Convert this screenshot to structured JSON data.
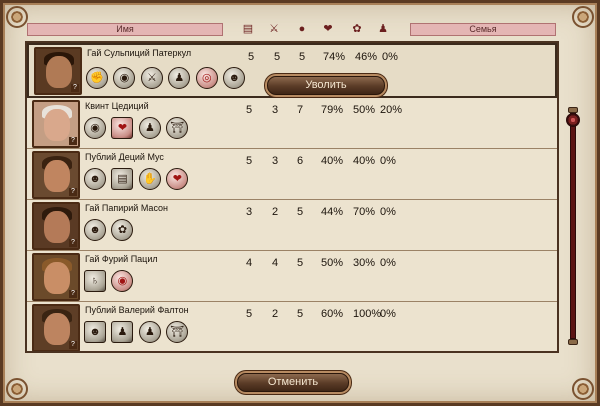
{
  "header": {
    "col_name": "Имя",
    "col_family": "Семья",
    "icons": [
      "scroll-icon",
      "crossed-swords-icon",
      "coins-icon",
      "heart-icon",
      "laurel-icon",
      "figure-icon"
    ]
  },
  "members": [
    {
      "name": "Гай Сульпиций Патеркул",
      "stats": [
        "5",
        "5",
        "5",
        "74%",
        "46%",
        "0%"
      ],
      "traits": [
        "fist-icon",
        "coin-icon",
        "fighter-icon",
        "pair-icon",
        "target-icon",
        "bust-icon"
      ]
    },
    {
      "name": "Квинт Цедиций",
      "stats": [
        "5",
        "3",
        "7",
        "79%",
        "50%",
        "20%"
      ],
      "traits": [
        "coins-icon",
        "heart-icon",
        "soldier-icon",
        "temple-icon"
      ]
    },
    {
      "name": "Публий Деций Мус",
      "stats": [
        "5",
        "3",
        "6",
        "40%",
        "40%",
        "0%"
      ],
      "traits": [
        "portrait-icon",
        "scroll-icon",
        "hand-icon",
        "heart-figure-icon"
      ]
    },
    {
      "name": "Гай Папирий Масон",
      "stats": [
        "3",
        "2",
        "5",
        "44%",
        "70%",
        "0%"
      ],
      "traits": [
        "head-icon",
        "wreath-icon"
      ]
    },
    {
      "name": "Гай Фурий Пацил",
      "stats": [
        "4",
        "4",
        "5",
        "50%",
        "30%",
        "0%"
      ],
      "traits": [
        "eagle-icon",
        "eye-icon"
      ]
    },
    {
      "name": "Публий Валерий Фалтон",
      "stats": [
        "5",
        "2",
        "5",
        "60%",
        "100%",
        "0%"
      ],
      "traits": [
        "face-icon",
        "group-icon",
        "pair-icon",
        "temple-icon"
      ]
    }
  ],
  "buttons": {
    "dismiss": "Уволить",
    "cancel": "Отменить"
  },
  "colors": {
    "parchment": "#ece3cf",
    "frame": "#5a3a22",
    "header_pink": "#e4b5b4",
    "button": "#5a3b26",
    "scrollbar": "#5b1414"
  }
}
